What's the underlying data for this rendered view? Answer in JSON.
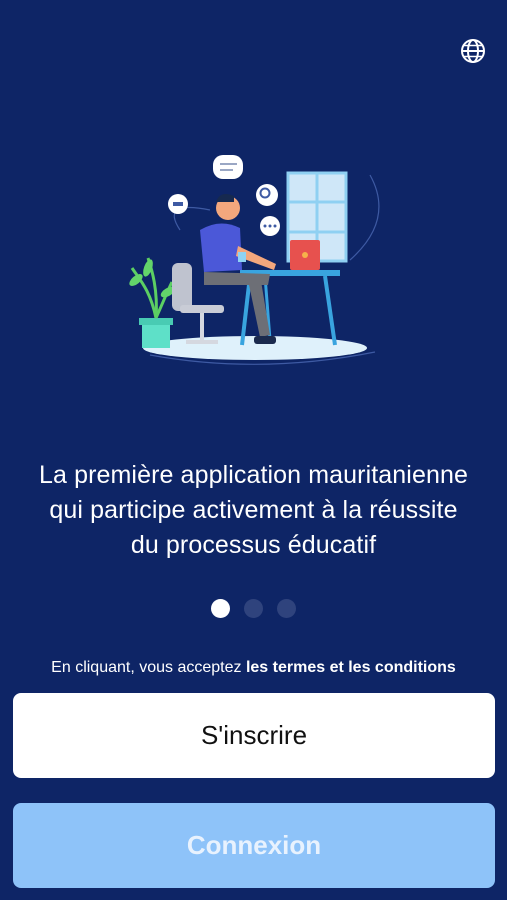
{
  "header": {
    "language_icon": "globe-icon"
  },
  "onboarding": {
    "illustration_icon": "person-working-at-desk-illustration",
    "headline_lines": [
      "La première application mauritanienne",
      "qui participe activement à la réussite",
      "du processus éducatif"
    ],
    "pager": {
      "current_page": 1,
      "total_pages": 3
    }
  },
  "terms": {
    "prefix": "En cliquant, vous acceptez ",
    "link": "les termes et les conditions"
  },
  "actions": {
    "signup_label": "S'inscrire",
    "login_label": "Connexion"
  },
  "colors": {
    "background": "#0e2566",
    "primary_button": "#ffffff",
    "secondary_button": "#8ec3f9",
    "dot_inactive": "#2f437d"
  }
}
